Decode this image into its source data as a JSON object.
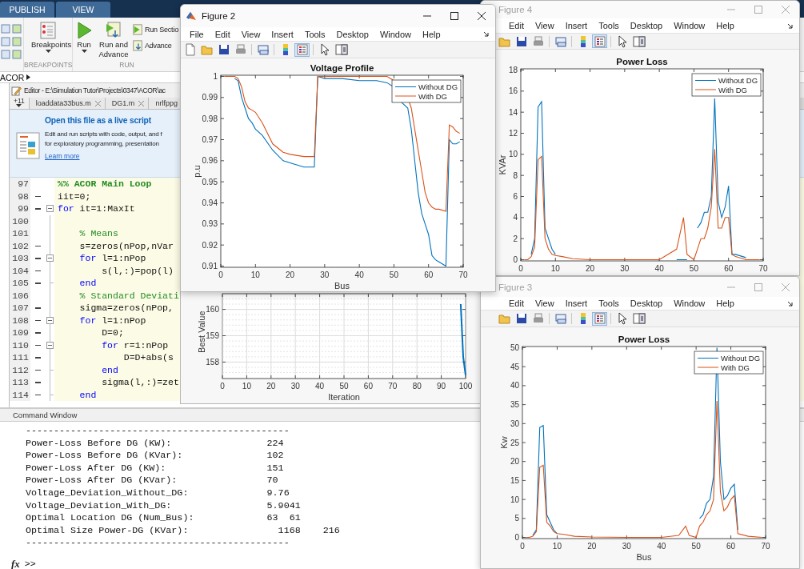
{
  "ribbon": {
    "tabs": [
      {
        "label": "PUBLISH",
        "selected": false
      },
      {
        "label": "VIEW",
        "selected": false
      }
    ],
    "groups": [
      {
        "label": "BREAKPOINTS",
        "buttons": [
          {
            "label": "Breakpoints",
            "kind": "breakpoints"
          }
        ]
      },
      {
        "label": "RUN",
        "buttons": [
          {
            "label": "Run",
            "kind": "run"
          },
          {
            "label": "Run and Advance",
            "kind": "run_advance"
          }
        ],
        "small_buttons": [
          {
            "label": "Run Sectio",
            "kind": "run_section"
          },
          {
            "label": "Advance",
            "kind": "advance"
          }
        ]
      }
    ]
  },
  "path_bar": {
    "crumbs": [
      "ACOR"
    ]
  },
  "editor": {
    "title": "Editor - E:\\Simulation Tutor\\Projects\\0347\\ACOR\\ac",
    "tabs": [
      {
        "label": "+11",
        "kind": "overflow"
      },
      {
        "label": "loaddata33bus.m",
        "kind": "file",
        "closable": true
      },
      {
        "label": "DG1.m",
        "kind": "file",
        "closable": true
      },
      {
        "label": "nrlfppg",
        "kind": "file",
        "closable": false
      }
    ],
    "banner": {
      "title": "Open this file as a live script",
      "lines": [
        "Edit and run scripts with code, output, and f",
        "for exploratory programming, presentation"
      ],
      "link": "Learn more"
    },
    "code_lines": [
      {
        "num": "97",
        "executable": false,
        "collapsible": false,
        "block_line": false,
        "block_end": false,
        "tokens": [
          {
            "kind": "section",
            "text": "%% ACOR Main Loop"
          }
        ]
      },
      {
        "num": "98",
        "executable": true,
        "collapsible": false,
        "block_line": false,
        "block_end": false,
        "tokens": [
          {
            "kind": "code",
            "text": "iit=0;"
          }
        ]
      },
      {
        "num": "99",
        "executable": true,
        "collapsible": true,
        "block_line": false,
        "block_end": false,
        "tokens": [
          {
            "kind": "keyword",
            "text": "for"
          },
          {
            "kind": "code",
            "text": " it=1:MaxIt"
          }
        ]
      },
      {
        "num": "100",
        "executable": false,
        "collapsible": false,
        "block_line": true,
        "block_end": false
      },
      {
        "num": "101",
        "executable": false,
        "collapsible": false,
        "block_line": true,
        "block_end": false,
        "tokens": [
          {
            "kind": "comment",
            "text": "    % Means"
          }
        ]
      },
      {
        "num": "102",
        "executable": true,
        "collapsible": false,
        "block_line": true,
        "block_end": false,
        "tokens": [
          {
            "kind": "code",
            "text": "    s=zeros(nPop,nVar"
          }
        ]
      },
      {
        "num": "103",
        "executable": true,
        "collapsible": true,
        "block_line": true,
        "block_end": false,
        "tokens": [
          {
            "kind": "keyword",
            "text": "    for"
          },
          {
            "kind": "code",
            "text": " l=1:nPop"
          }
        ]
      },
      {
        "num": "104",
        "executable": true,
        "collapsible": false,
        "block_line": true,
        "block_end": false,
        "tokens": [
          {
            "kind": "code",
            "text": "        s(l,:)=pop(l)"
          }
        ]
      },
      {
        "num": "105",
        "executable": true,
        "collapsible": false,
        "block_line": true,
        "block_end": true,
        "tokens": [
          {
            "kind": "keyword",
            "text": "    end"
          }
        ]
      },
      {
        "num": "106",
        "executable": false,
        "collapsible": false,
        "block_line": true,
        "block_end": false,
        "tokens": [
          {
            "kind": "comment",
            "text": "    % Standard Deviati"
          }
        ]
      },
      {
        "num": "107",
        "executable": true,
        "collapsible": false,
        "block_line": true,
        "block_end": false,
        "tokens": [
          {
            "kind": "code",
            "text": "    sigma=zeros(nPop,"
          }
        ]
      },
      {
        "num": "108",
        "executable": true,
        "collapsible": true,
        "block_line": true,
        "block_end": false,
        "tokens": [
          {
            "kind": "keyword",
            "text": "    for"
          },
          {
            "kind": "code",
            "text": " l=1:nPop"
          }
        ]
      },
      {
        "num": "109",
        "executable": true,
        "collapsible": false,
        "block_line": true,
        "block_end": false,
        "tokens": [
          {
            "kind": "code",
            "text": "        D=0;"
          }
        ]
      },
      {
        "num": "110",
        "executable": true,
        "collapsible": true,
        "block_line": true,
        "block_end": false,
        "tokens": [
          {
            "kind": "keyword",
            "text": "        for"
          },
          {
            "kind": "code",
            "text": " r=1:nPop"
          }
        ]
      },
      {
        "num": "111",
        "executable": true,
        "collapsible": false,
        "block_line": true,
        "block_end": false,
        "tokens": [
          {
            "kind": "code",
            "text": "            D=D+abs(s"
          }
        ]
      },
      {
        "num": "112",
        "executable": true,
        "collapsible": false,
        "block_line": true,
        "block_end": true,
        "tokens": [
          {
            "kind": "keyword",
            "text": "        end"
          }
        ]
      },
      {
        "num": "113",
        "executable": true,
        "collapsible": false,
        "block_line": true,
        "block_end": false,
        "tokens": [
          {
            "kind": "code",
            "text": "        sigma(l,:)=zet"
          }
        ]
      },
      {
        "num": "114",
        "executable": true,
        "collapsible": false,
        "block_line": true,
        "block_end": true,
        "tokens": [
          {
            "kind": "keyword",
            "text": "    end"
          }
        ]
      }
    ]
  },
  "command_window": {
    "title": "Command Window",
    "lines": [
      "-----------------------------------------------",
      "Power-Loss Before DG (KW):                 224",
      "Power-Loss Before DG (KVar):               102",
      "Power-Loss After DG (KW):                  151",
      "Power-Loss After DG (KVar):                70",
      "Voltage_Deviation_Without_DG:              9.76",
      "Voltage_Deviation_With_DG:                 5.9041",
      "Optimal Location DG (Num_Bus):             63  61",
      "Optimal Size Power-DG (KVar):                1168    216",
      "-----------------------------------------------"
    ],
    "fx": "fx",
    "prompt": ">>"
  },
  "figures": [
    {
      "title": "Figure 2",
      "active": true,
      "kind": "full",
      "menu": [
        "File",
        "Edit",
        "View",
        "Insert",
        "Tools",
        "Desktop",
        "Window",
        "Help"
      ],
      "toolbar": {
        "legend_on": true
      },
      "chart_data": {
        "type": "line",
        "title": "Voltage Profile",
        "xlabel": "Bus",
        "ylabel": "p.u",
        "legend": "upper right",
        "x": [
          1,
          2,
          3,
          4,
          5,
          6,
          7,
          8,
          9,
          10,
          12,
          15,
          18,
          20,
          24,
          27,
          28,
          30,
          35,
          40,
          45,
          48,
          50,
          51,
          52,
          54,
          55,
          56,
          57,
          58,
          59,
          60,
          61,
          62,
          63,
          65,
          66,
          67,
          68,
          69
        ],
        "series": [
          {
            "name": "Without DG",
            "color": "#0072bd",
            "values": [
              null,
              null,
              null,
              0.999,
              0.998,
              0.99,
              0.985,
              0.98,
              0.978,
              0.975,
              0.972,
              0.965,
              0.96,
              0.959,
              0.957,
              0.957,
              1,
              0.999,
              0.999,
              0.998,
              0.998,
              0.997,
              0.995,
              null,
              0.988,
              0.985,
              0.975,
              0.96,
              0.945,
              0.935,
              0.93,
              0.925,
              0.915,
              0.913,
              0.912,
              0.91,
              0.97,
              0.968,
              0.968,
              0.969
            ]
          },
          {
            "name": "With DG",
            "color": "#d95319",
            "values": [
              1,
              1,
              1,
              1,
              0.999,
              0.995,
              0.988,
              0.985,
              0.984,
              0.983,
              0.978,
              0.968,
              0.964,
              0.963,
              0.962,
              0.962,
              1,
              1,
              1,
              1,
              1,
              1,
              0.998,
              null,
              null,
              0.99,
              0.985,
              0.975,
              0.965,
              0.955,
              0.945,
              0.94,
              0.938,
              0.937,
              0.937,
              0.936,
              0.977,
              0.976,
              0.974,
              0.973
            ]
          }
        ],
        "xlim": [
          0,
          70
        ],
        "ylim": [
          0.91,
          1
        ],
        "xticks": [
          0,
          10,
          20,
          30,
          40,
          50,
          60,
          70
        ],
        "yticks": [
          0.91,
          0.92,
          0.93,
          0.94,
          0.95,
          0.96,
          0.97,
          0.98,
          0.99,
          1
        ]
      }
    },
    {
      "kind": "body",
      "chart_data": {
        "type": "line",
        "xlabel": "Iteration",
        "ylabel": "Best Value",
        "grid": true,
        "x": [
          98,
          99,
          100
        ],
        "series": [
          {
            "color": "#0072bd",
            "values": [
              160.2,
              158.2,
              157.5
            ]
          }
        ],
        "xlim": [
          0,
          100
        ],
        "ylim": [
          157.42,
          160.55
        ],
        "xticks": [
          0,
          10,
          20,
          30,
          40,
          50,
          60,
          70,
          80,
          90,
          100
        ],
        "yticks": [
          158,
          159,
          160
        ]
      }
    },
    {
      "title": "Figure 4",
      "active": false,
      "kind": "clipped",
      "menu": [
        "Edit",
        "View",
        "Insert",
        "Tools",
        "Desktop",
        "Window",
        "Help"
      ],
      "toolbar": {
        "legend_on": true
      },
      "chart_data": {
        "type": "line",
        "title": "Power Loss",
        "ylabel": "KVAr",
        "legend": "upper right",
        "x": [
          1,
          2,
          3,
          4,
          5,
          6,
          7,
          8,
          9,
          10,
          12,
          15,
          20,
          30,
          40,
          45,
          47,
          48,
          50,
          51,
          52,
          53,
          54,
          55,
          56,
          57,
          58,
          59,
          60,
          61,
          62,
          65,
          69
        ],
        "series": [
          {
            "name": "Without DG",
            "color": "#0072bd",
            "values": [
              null,
              null,
              0.5,
              2,
              14.5,
              15,
              3,
              2,
              1,
              0.5,
              null,
              null,
              null,
              null,
              null,
              0,
              0,
              0,
              null,
              3,
              3.5,
              4.5,
              4.5,
              6,
              15.3,
              5.5,
              4,
              5,
              7,
              0.5,
              0.5,
              0.2,
              null
            ]
          },
          {
            "name": "With DG",
            "color": "#d95319",
            "values": [
              0,
              0,
              0.3,
              1.2,
              9.5,
              9.8,
              2,
              1,
              0.5,
              0.4,
              0.3,
              0.1,
              0,
              0,
              0,
              1,
              4,
              0.5,
              0,
              1,
              2,
              2,
              3,
              5,
              10.5,
              3,
              3,
              4,
              4,
              0.5,
              0.3,
              0,
              0
            ]
          }
        ],
        "xlim": [
          0,
          70
        ],
        "ylim": [
          0,
          18
        ],
        "xticks": [
          0,
          10,
          20,
          30,
          40,
          50,
          60,
          70
        ],
        "yticks": [
          0,
          2,
          4,
          6,
          8,
          10,
          12,
          14,
          16,
          18
        ]
      }
    },
    {
      "title": "Figure 3",
      "active": false,
      "kind": "clipped",
      "menu": [
        "Edit",
        "View",
        "Insert",
        "Tools",
        "Desktop",
        "Window",
        "Help"
      ],
      "toolbar": {
        "legend_on": true
      },
      "chart_data": {
        "type": "line",
        "title": "Power Loss",
        "xlabel": "Bus",
        "ylabel": "Kw",
        "legend": "upper right",
        "x": [
          1,
          2,
          3,
          4,
          5,
          6,
          7,
          8,
          9,
          10,
          12,
          15,
          20,
          30,
          40,
          45,
          47,
          48,
          50,
          51,
          52,
          53,
          54,
          55,
          56,
          57,
          58,
          59,
          60,
          61,
          62,
          65,
          69
        ],
        "series": [
          {
            "name": "Without DG",
            "color": "#0072bd",
            "values": [
              null,
              null,
              0.5,
              2,
              29,
              29.5,
              6,
              4,
              2,
              1,
              null,
              null,
              null,
              null,
              null,
              null,
              null,
              null,
              null,
              5,
              6,
              9,
              10,
              16,
              50,
              20,
              10,
              11,
              13,
              14,
              2,
              null,
              null
            ]
          },
          {
            "name": "With DG",
            "color": "#d95319",
            "values": [
              0,
              0,
              0.3,
              1.5,
              18.5,
              19,
              4,
              3,
              1.5,
              1,
              0.8,
              0.3,
              0.1,
              0,
              0,
              0.5,
              3,
              0.5,
              0,
              3,
              4,
              6,
              7,
              10,
              36,
              12,
              7,
              8,
              10,
              11,
              1,
              0.3,
              0
            ]
          }
        ],
        "xlim": [
          0,
          70
        ],
        "ylim": [
          0,
          50
        ],
        "xticks": [
          0,
          10,
          20,
          30,
          40,
          50,
          60,
          70
        ],
        "yticks": [
          0,
          5,
          10,
          15,
          20,
          25,
          30,
          35,
          40,
          45,
          50
        ]
      }
    }
  ]
}
